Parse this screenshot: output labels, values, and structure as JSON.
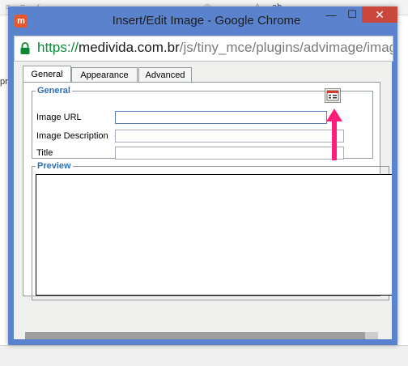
{
  "window": {
    "title": "Insert/Edit Image - Google Chrome",
    "minimize_glyph": "—",
    "maximize_glyph": "☐",
    "close_glyph": "✕",
    "app_icon_letter": "m"
  },
  "address": {
    "scheme": "https://",
    "host": "medivida.com.br",
    "path": "/js/tiny_mce/plugins/advimage/image"
  },
  "tabs": [
    {
      "label": "General",
      "active": true
    },
    {
      "label": "Appearance",
      "active": false
    },
    {
      "label": "Advanced",
      "active": false
    }
  ],
  "general": {
    "legend": "General",
    "fields": {
      "image_url": {
        "label": "Image URL",
        "value": ""
      },
      "image_description": {
        "label": "Image Description",
        "value": ""
      },
      "title": {
        "label": "Title",
        "value": ""
      }
    }
  },
  "preview": {
    "legend": "Preview"
  },
  "background": {
    "left_text": "pr"
  },
  "colors": {
    "window_frame": "#5b82cc",
    "close_button": "#c9473b",
    "legend_blue": "#2b6fb6",
    "arrow_pink": "#ff1f7a",
    "https_green": "#0b8a34"
  },
  "icons": [
    "lock-icon",
    "browse-icon",
    "app-icon",
    "annotation-arrow"
  ]
}
